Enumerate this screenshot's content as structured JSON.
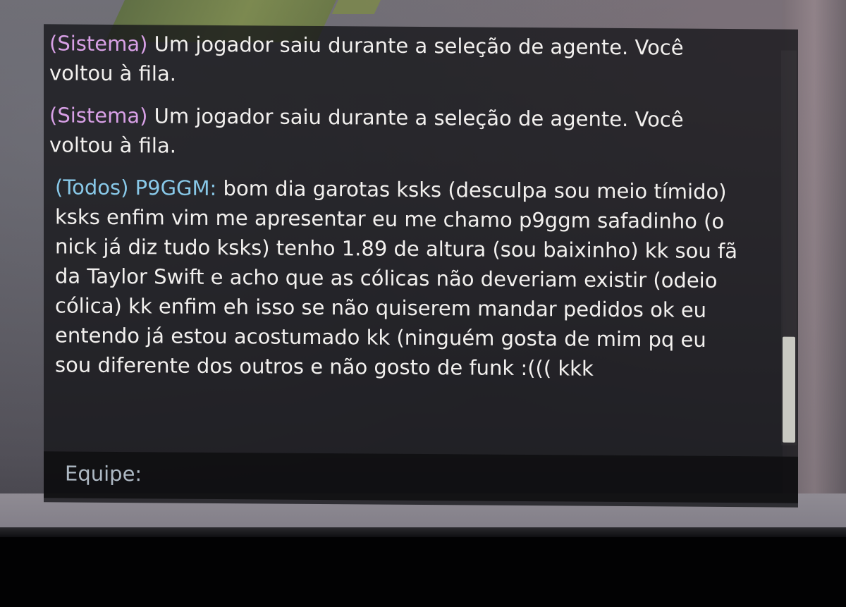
{
  "chat": {
    "messages": [
      {
        "channel": "(Sistema)",
        "sender": "",
        "text": "Um jogador saiu durante a seleção de agente. Você voltou à fila."
      },
      {
        "channel": "(Sistema)",
        "sender": "",
        "text": "Um jogador saiu durante a seleção de agente. Você voltou à fila."
      },
      {
        "channel": "(Todos)",
        "sender": "P9GGM:",
        "text": "bom dia garotas ksks (desculpa sou meio tímido) ksks enfim vim me apresentar eu me chamo p9ggm safadinho (o nick já diz tudo ksks) tenho 1.89 de altura (sou baixinho) kk sou fã da Taylor Swift e acho que as cólicas não deveriam existir (odeio cólica) kk enfim eh isso se não quiserem mandar pedidos ok eu entendo já estou acostumado kk (ninguém gosta de mim pq eu sou diferente dos outros e não gosto de funk :((( kkk"
      }
    ],
    "input": {
      "label": "Equipe:",
      "value": ""
    }
  },
  "colors": {
    "system_channel": "#d8a0e6",
    "all_channel": "#88c8e8",
    "message_text": "#f2f0ee",
    "input_label": "#aeb9c4"
  }
}
